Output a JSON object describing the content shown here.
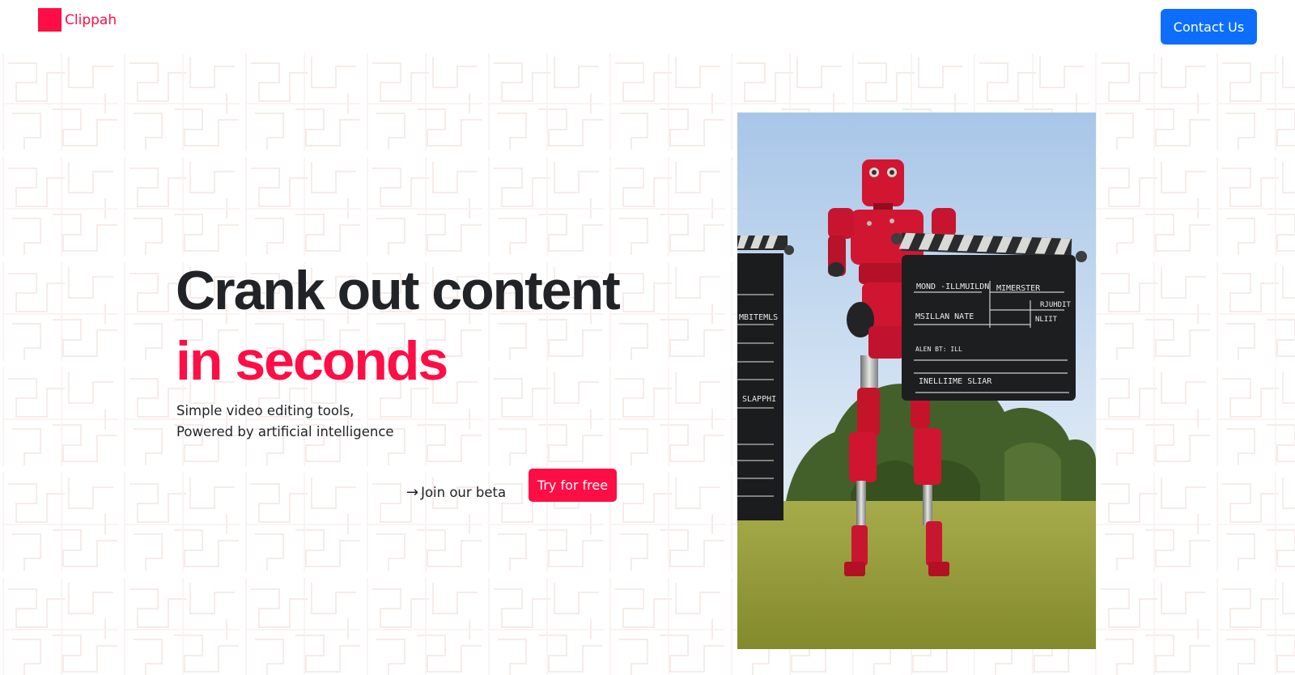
{
  "header": {
    "brand_name": "Clippah",
    "brand_color": "#ff0d45",
    "contact_label": "Contact Us",
    "contact_color": "#0d6efd"
  },
  "hero": {
    "headline_line1": "Crank out content",
    "headline_line2": "in seconds",
    "subtext_line1": "Simple video editing tools,",
    "subtext_line2": "Powered by artificial intelligence",
    "beta_arrow": "→",
    "beta_label": "Join our beta",
    "cta_label": "Try for free",
    "image_alt": "Red robot holding a clapperboard in a grassy field",
    "clapper_main": {
      "row1_left": "MOND -ILLMUILDN",
      "row1_right": "MIMERSTER",
      "row2_left": "MSILLAN NATE",
      "row2_right_top": "RJUHDIT",
      "row2_right_bottom": "NLIIT",
      "row3": "ALEN BT: ILL",
      "row4": "INELLIIME SLIAR"
    },
    "clapper_side": {
      "row1": "MBITEMLS",
      "row2": "SLAPPHI"
    }
  }
}
